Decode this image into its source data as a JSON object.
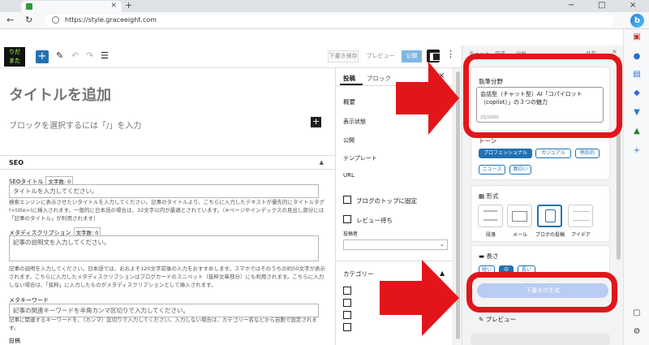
{
  "browser": {
    "url": "https://style.graceeight.com",
    "tab_close": "×",
    "new_tab": "+",
    "min": "−",
    "max": "□",
    "close": "×",
    "back": "←",
    "reload": "↻"
  },
  "logo_text": "りだ\nまた",
  "toolbar": {
    "add": "+",
    "draft_save": "下書き保存",
    "preview": "プレビュー",
    "publish": "公開",
    "more": "⋮"
  },
  "editor": {
    "title_placeholder": "タイトルを追加",
    "block_placeholder": "ブロックを選択するには「/」を入力",
    "add_block": "+"
  },
  "seo": {
    "heading": "SEO",
    "caret": "▲",
    "seo_title_label": "SEOタイトル",
    "seo_title_count": "文字数: 0",
    "seo_title_placeholder": "タイトルを入力してください。",
    "seo_title_desc": "検索エンジンに表示させたいタイトルを入力してください。記事のタイトルより、こちらに入力したテキストが優先的にタイトルタグ(<title>)に挿入されます。一般的に日本語の場合は、32文字以内が最適とされています。（※ページやインデックスの見出し部分には「記事のタイトル」が利用されます）",
    "meta_desc_label": "メタディスクリプション",
    "meta_desc_count": "文字数: 0",
    "meta_desc_placeholder": "記事の説明文を入力してください。",
    "meta_desc_desc": "記事の説明を入力してください。日本語では、おおよそ120文字前後の入力をおすすめします。スマホではそのうちの約50文字が表示されます。こちらに入力したメタディスクリプションはブログカードのスニペット（抜粋文章部分）にも利用されます。こちらに入力しない場合は、「抜粋」に入力したものがメタディスクリプションとして挿入されます。",
    "keyword_label": "メタキーワード",
    "keyword_placeholder": "記事の関連キーワードを半角カンマ区切りで入力してください。",
    "keyword_desc": "記事に関連するキーワードを、（カンマ）区切りで入力してください。入力しない場合は、カテゴリー名などから自動で設定されます。",
    "footer_label": "投稿"
  },
  "settings": {
    "tab_post": "投稿",
    "tab_block": "ブロック",
    "close": "×",
    "summary": "概要",
    "caret_up": "▲",
    "visibility": "表示状態",
    "publish": "公開",
    "template": "テンプレート",
    "url": "URL",
    "sticky": "ブログのトップに固定",
    "pending": "レビュー待ち",
    "author": "投稿者",
    "select_caret": "⌄",
    "category": "カテゴリー"
  },
  "ai": {
    "tabs": [
      "チャット",
      "作成",
      "分析",
      "共有",
      "×"
    ],
    "field_label": "執筆分野",
    "field_value": "会話型（チャット型）AI「コパイロット（copilot）」の３つの魅力",
    "char_count": "25/2000",
    "tone_label": "トーン",
    "tones": [
      "プロフェッショナル",
      "カジュアル",
      "熱狂的",
      "ニュース",
      "面白い"
    ],
    "format_label": "形式",
    "formats": [
      "段落",
      "メール",
      "ブログの投稿",
      "アイデア"
    ],
    "length_label": "長さ",
    "lengths": [
      "短い",
      "中",
      "長い"
    ],
    "generate": "下書きの生成",
    "preview_label": "プレビュー"
  },
  "colors": {
    "accent": "#2271b1",
    "highlight": "#e3151b",
    "generate_button": "#b8ccf4"
  }
}
